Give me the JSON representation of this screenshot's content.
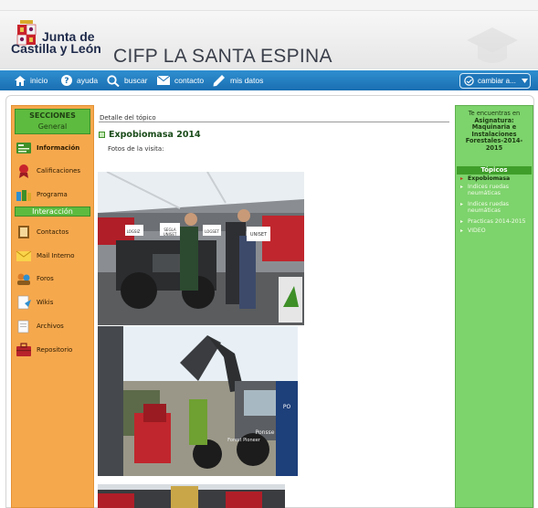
{
  "header": {
    "logo_line1": "Junta de",
    "logo_line2": "Castilla y León",
    "site_title": "CIFP LA SANTA ESPINA"
  },
  "nav": {
    "items": [
      {
        "label": "inicio",
        "icon": "home-icon"
      },
      {
        "label": "ayuda",
        "icon": "help-icon"
      },
      {
        "label": "buscar",
        "icon": "search-icon"
      },
      {
        "label": "contacto",
        "icon": "mail-icon"
      },
      {
        "label": "mis datos",
        "icon": "pencil-icon"
      }
    ],
    "change_label": "cambiar a..."
  },
  "sidebar": {
    "sections_title": "SECCIONES",
    "general_title": "General",
    "general_items": [
      {
        "label": "Información",
        "icon": "info-icon",
        "active": true
      },
      {
        "label": "Calificaciones",
        "icon": "medal-icon"
      },
      {
        "label": "Programa",
        "icon": "program-icon"
      }
    ],
    "interaction_title": "Interacción",
    "interaction_items": [
      {
        "label": "Contactos",
        "icon": "contacts-icon"
      },
      {
        "label": "Mail Interno",
        "icon": "mail-icon"
      },
      {
        "label": "Foros",
        "icon": "forum-icon"
      },
      {
        "label": "Wikis",
        "icon": "wiki-icon"
      },
      {
        "label": "Archivos",
        "icon": "folder-icon"
      },
      {
        "label": "Repositorio",
        "icon": "briefcase-icon"
      }
    ]
  },
  "main": {
    "breadcrumb": "Detalle del tópico",
    "title": "Expobiomasa 2014",
    "subtitle": "Fotos de la visita:",
    "photo1_signs": [
      "LOGSIZ",
      "SEGLA",
      "UNISET",
      "LOGSET",
      "UNISET"
    ],
    "photo2_signs": [
      "Ponsse",
      "Forest Pioneer",
      "PO"
    ]
  },
  "right": {
    "you_are_in": "Te encuentras en",
    "subject_label": "Asignatura:",
    "subject_name": "Maquinaria e Instalaciones Forestales-2014-2015",
    "topics_title": "Tópicos",
    "topics": [
      {
        "label": "Expobiomasa",
        "current": true
      },
      {
        "label": "Indices ruedas neumáticas"
      },
      {
        "label": "Indices ruedas neumáticas"
      },
      {
        "label": "Practicas 2014-2015"
      },
      {
        "label": "VIDEO"
      }
    ]
  },
  "colors": {
    "nav_blue": "#1a6fb2",
    "sidebar_orange": "#f6a84d",
    "section_green": "#5dbb3f",
    "right_green": "#7dd36c"
  }
}
